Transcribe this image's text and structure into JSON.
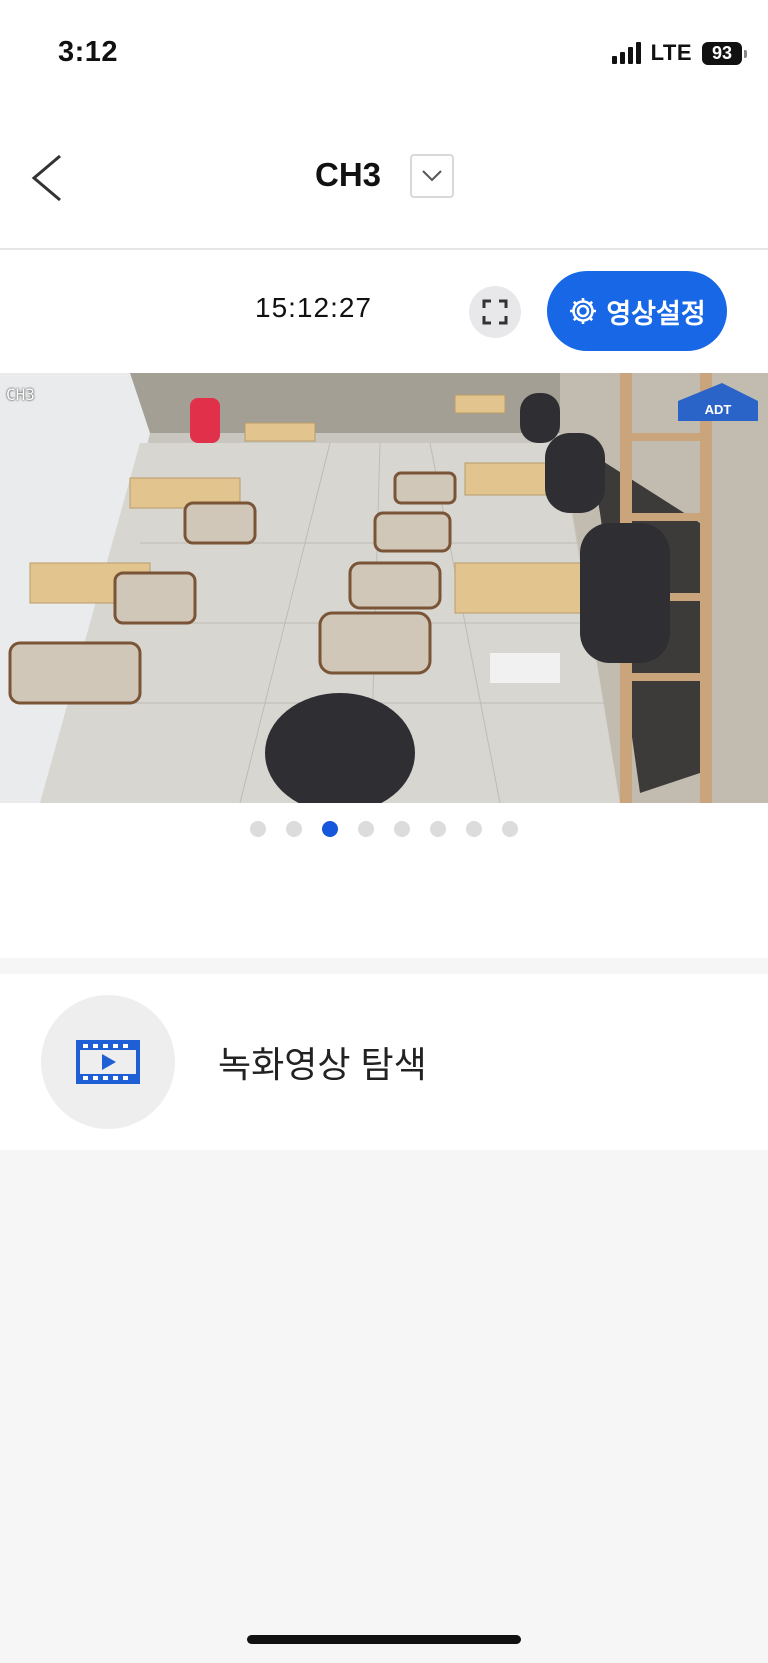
{
  "status_bar": {
    "time": "3:12",
    "network": "LTE",
    "battery": "93"
  },
  "header": {
    "title": "CH3"
  },
  "toolbar": {
    "clock": "15:12:27",
    "settings_label": "영상설정"
  },
  "feed": {
    "channel_overlay": "CH3",
    "logo_text": "ADT"
  },
  "pager": {
    "count": 8,
    "active_index": 2
  },
  "actions": {
    "search_recordings_label": "녹화영상 탐색"
  },
  "colors": {
    "accent": "#1767e6",
    "dot_active": "#1657db",
    "dot_inactive": "#dcdcdc"
  }
}
